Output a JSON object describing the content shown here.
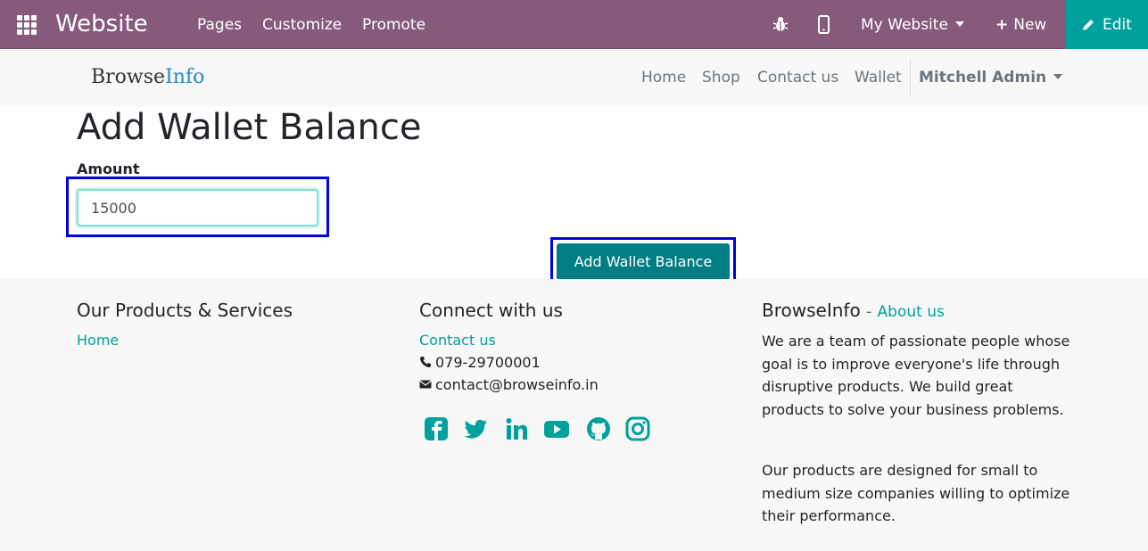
{
  "topbar": {
    "brand": "Website",
    "menu": [
      "Pages",
      "Customize",
      "Promote"
    ],
    "website_selector": "My Website",
    "new_label": "New",
    "edit_label": "Edit",
    "color": "#875a7b",
    "edit_color": "#00a09d"
  },
  "header": {
    "logo_part1": "Browse",
    "logo_part2": "Info",
    "nav": [
      "Home",
      "Shop",
      "Contact us",
      "Wallet"
    ],
    "user": "Mitchell Admin"
  },
  "main": {
    "title": "Add Wallet Balance",
    "amount_label": "Amount",
    "amount_value": "15000",
    "submit_label": "Add Wallet Balance",
    "button_color": "#017e84"
  },
  "footer": {
    "col1": {
      "heading": "Our Products & Services",
      "link": "Home"
    },
    "col2": {
      "heading": "Connect with us",
      "link": "Contact us",
      "phone": "079-29700001",
      "email": "contact@browseinfo.in",
      "social": [
        "facebook-icon",
        "twitter-icon",
        "linkedin-icon",
        "youtube-icon",
        "github-icon",
        "instagram-icon"
      ]
    },
    "col3": {
      "heading": "BrowseInfo",
      "separator": "-",
      "about_link": "About us",
      "para1": "We are a team of passionate people whose goal is to improve everyone's life through disruptive products. We build great products to solve your business problems.",
      "para2": "Our products are designed for small to medium size companies willing to optimize their performance."
    }
  }
}
